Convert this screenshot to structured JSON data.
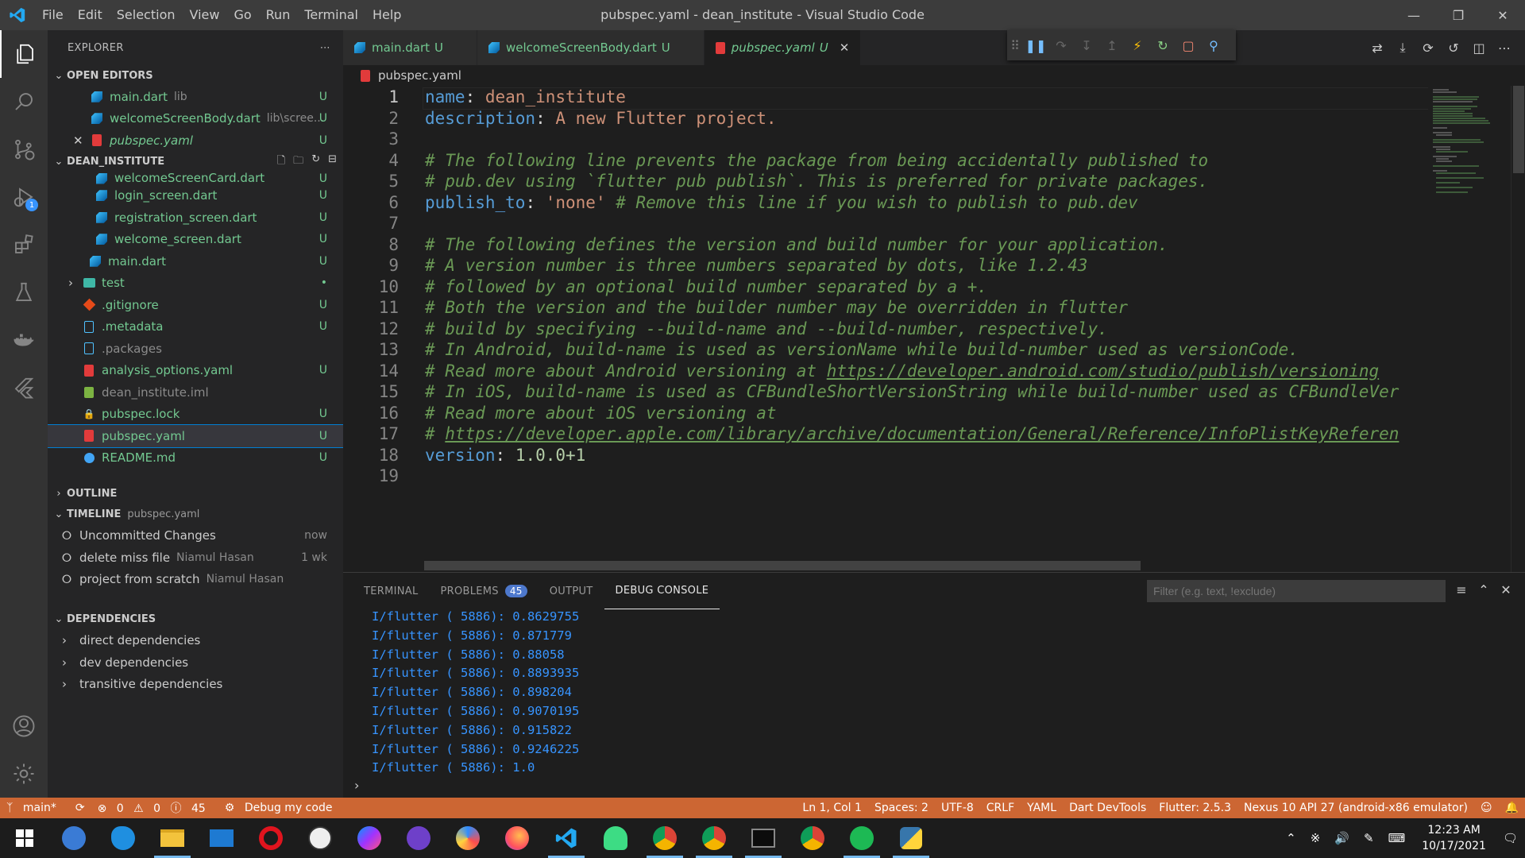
{
  "window": {
    "title": "pubspec.yaml - dean_institute - Visual Studio Code"
  },
  "menu": [
    "File",
    "Edit",
    "Selection",
    "View",
    "Go",
    "Run",
    "Terminal",
    "Help"
  ],
  "activity": {
    "debug_badge": "1"
  },
  "sidebar": {
    "title": "EXPLORER",
    "open_editors_label": "OPEN EDITORS",
    "open_editors": [
      {
        "name": "main.dart",
        "desc": "lib",
        "status": "U",
        "italic": false
      },
      {
        "name": "welcomeScreenBody.dart",
        "desc": "lib\\scree...",
        "status": "U",
        "italic": false
      },
      {
        "name": "pubspec.yaml",
        "desc": "",
        "status": "U",
        "italic": true
      }
    ],
    "project_label": "DEAN_INSTITUTE",
    "files": [
      {
        "name": "welcomeScreenCard.dart",
        "status": "U",
        "indent": 3,
        "icon": "dart"
      },
      {
        "name": "login_screen.dart",
        "status": "U",
        "indent": 3,
        "icon": "dart"
      },
      {
        "name": "registration_screen.dart",
        "status": "U",
        "indent": 3,
        "icon": "dart"
      },
      {
        "name": "welcome_screen.dart",
        "status": "U",
        "indent": 3,
        "icon": "dart"
      },
      {
        "name": "main.dart",
        "status": "U",
        "indent": 2,
        "icon": "dart"
      },
      {
        "name": "test",
        "status": "•",
        "indent": 1,
        "icon": "folder"
      },
      {
        "name": ".gitignore",
        "status": "U",
        "indent": 1,
        "icon": "git"
      },
      {
        "name": ".metadata",
        "status": "U",
        "indent": 1,
        "icon": "file"
      },
      {
        "name": ".packages",
        "status": "",
        "indent": 1,
        "icon": "file"
      },
      {
        "name": "analysis_options.yaml",
        "status": "U",
        "indent": 1,
        "icon": "yaml"
      },
      {
        "name": "dean_institute.iml",
        "status": "",
        "indent": 1,
        "icon": "iml"
      },
      {
        "name": "pubspec.lock",
        "status": "U",
        "indent": 1,
        "icon": "lock"
      },
      {
        "name": "pubspec.yaml",
        "status": "U",
        "indent": 1,
        "icon": "yaml"
      },
      {
        "name": "README.md",
        "status": "U",
        "indent": 1,
        "icon": "info"
      }
    ],
    "outline_label": "OUTLINE",
    "timeline_label": "TIMELINE",
    "timeline_sub": "pubspec.yaml",
    "timeline": [
      {
        "title": "Uncommitted Changes",
        "author": "",
        "when": "now"
      },
      {
        "title": "delete miss file",
        "author": "Niamul Hasan",
        "when": "1 wk"
      },
      {
        "title": "project from scratch",
        "author": "Niamul Hasan",
        "when": ""
      }
    ],
    "deps_label": "DEPENDENCIES",
    "deps": [
      "direct dependencies",
      "dev dependencies",
      "transitive dependencies"
    ]
  },
  "tabs": [
    {
      "name": "main.dart",
      "status": "U",
      "active": false
    },
    {
      "name": "welcomeScreenBody.dart",
      "status": "U",
      "active": false
    },
    {
      "name": "pubspec.yaml",
      "status": "U",
      "active": true
    }
  ],
  "breadcrumb": "pubspec.yaml",
  "editor": {
    "lines": [
      [
        [
          "k",
          "name"
        ],
        [
          "p",
          ": "
        ],
        [
          "s",
          "dean_institute"
        ]
      ],
      [
        [
          "k",
          "description"
        ],
        [
          "p",
          ": "
        ],
        [
          "s",
          "A new Flutter project."
        ]
      ],
      [],
      [
        [
          "c",
          "# The following line prevents the package from being accidentally published to"
        ]
      ],
      [
        [
          "c",
          "# pub.dev using `flutter pub publish`. This is preferred for private packages."
        ]
      ],
      [
        [
          "k",
          "publish_to"
        ],
        [
          "p",
          ": "
        ],
        [
          "sv",
          "'none'"
        ],
        [
          "p",
          " "
        ],
        [
          "c",
          "# Remove this line if you wish to publish to pub.dev"
        ]
      ],
      [],
      [
        [
          "c",
          "# The following defines the version and build number for your application."
        ]
      ],
      [
        [
          "c",
          "# A version number is three numbers separated by dots, like 1.2.43"
        ]
      ],
      [
        [
          "c",
          "# followed by an optional build number separated by a +."
        ]
      ],
      [
        [
          "c",
          "# Both the version and the builder number may be overridden in flutter"
        ]
      ],
      [
        [
          "c",
          "# build by specifying --build-name and --build-number, respectively."
        ]
      ],
      [
        [
          "c",
          "# In Android, build-name is used as versionName while build-number used as versionCode."
        ]
      ],
      [
        [
          "c",
          "# Read more about Android versioning at "
        ],
        [
          "cu",
          "https://developer.android.com/studio/publish/versioning"
        ]
      ],
      [
        [
          "c",
          "# In iOS, build-name is used as CFBundleShortVersionString while build-number used as CFBundleVer"
        ]
      ],
      [
        [
          "c",
          "# Read more about iOS versioning at"
        ]
      ],
      [
        [
          "c",
          "# "
        ],
        [
          "cu",
          "https://developer.apple.com/library/archive/documentation/General/Reference/InfoPlistKeyReferen"
        ]
      ],
      [
        [
          "k",
          "version"
        ],
        [
          "p",
          ": "
        ],
        [
          "v",
          "1.0.0+1"
        ]
      ],
      []
    ]
  },
  "panel": {
    "tabs": [
      "TERMINAL",
      "PROBLEMS",
      "OUTPUT",
      "DEBUG CONSOLE"
    ],
    "problems_count": "45",
    "filter_placeholder": "Filter (e.g. text, !exclude)",
    "console": [
      "I/flutter ( 5886): 0.8629755",
      "I/flutter ( 5886): 0.871779",
      "I/flutter ( 5886): 0.88058",
      "I/flutter ( 5886): 0.8893935",
      "I/flutter ( 5886): 0.898204",
      "I/flutter ( 5886): 0.9070195",
      "I/flutter ( 5886): 0.915822",
      "I/flutter ( 5886): 0.9246225",
      "I/flutter ( 5886): 1.0"
    ]
  },
  "status": {
    "branch": "main*",
    "errors": "0",
    "warnings": "0",
    "infos": "45",
    "debug": "Debug my code",
    "right": [
      "Ln 1, Col 1",
      "Spaces: 2",
      "UTF-8",
      "CRLF",
      "YAML",
      "Dart DevTools",
      "Flutter: 2.5.3",
      "Nexus 10 API 27 (android-x86 emulator)"
    ]
  },
  "taskbar": {
    "time": "12:23 AM",
    "date": "10/17/2021"
  },
  "colors": {
    "statusbar": "#cc6633",
    "accent": "#007acc"
  }
}
